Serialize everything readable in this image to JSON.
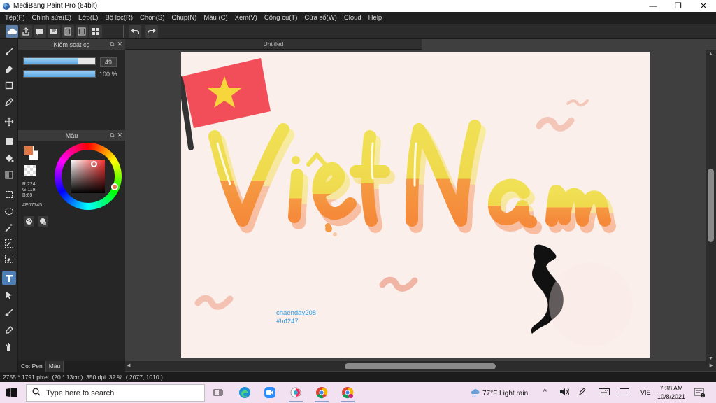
{
  "window": {
    "title": "MediBang Paint Pro (64bit)"
  },
  "window_controls": {
    "minimize": "—",
    "maximize": "❐",
    "close": "✕"
  },
  "menu": [
    "Tệp(F)",
    "Chỉnh sửa(E)",
    "Lớp(L)",
    "Bộ lọc(R)",
    "Chọn(S)",
    "Chụp(N)",
    "Màu (C)",
    "Xem(V)",
    "Công cụ(T)",
    "Cửa sổ(W)",
    "Cloud",
    "Help"
  ],
  "brush_panel": {
    "title": "Kiểm soát cọ",
    "size_value": "49",
    "size_fill": 0.76,
    "opacity_value": "100 %",
    "opacity_fill": 1.0
  },
  "color_panel": {
    "title": "Màu",
    "r": "R:224",
    "g": "G:119",
    "b": "B:69",
    "hex": "#E07745",
    "primary_color": "#E07745",
    "secondary_color": "#FFFFFF"
  },
  "bottom_tabs": [
    "Co: Pen",
    "Màu"
  ],
  "document": {
    "tab_title": "Untitled",
    "canvas_text_line1": "chaenday208",
    "canvas_text_line2": "#hđ247",
    "artwork_title": "Việt Nam"
  },
  "status": {
    "dimensions": "2755 * 1791 pixel",
    "physical": "(20 * 13cm)",
    "dpi": "350 dpi",
    "zoom": "32 %",
    "coords": "( 2077, 1010 )"
  },
  "taskbar": {
    "search_placeholder": "Type here to search",
    "weather": "77°F  Light rain",
    "language": "VIE",
    "time": "7:38 AM",
    "date": "10/8/2021"
  },
  "colors": {
    "accent": "#4D7FB6",
    "canvas_bg": "#FBEFEC",
    "flag_red": "#F24E5A",
    "flag_star": "#F6D63A",
    "text_yellow": "#F0E055",
    "text_orange": "#F59A42",
    "link_blue": "#2E9BE0"
  }
}
